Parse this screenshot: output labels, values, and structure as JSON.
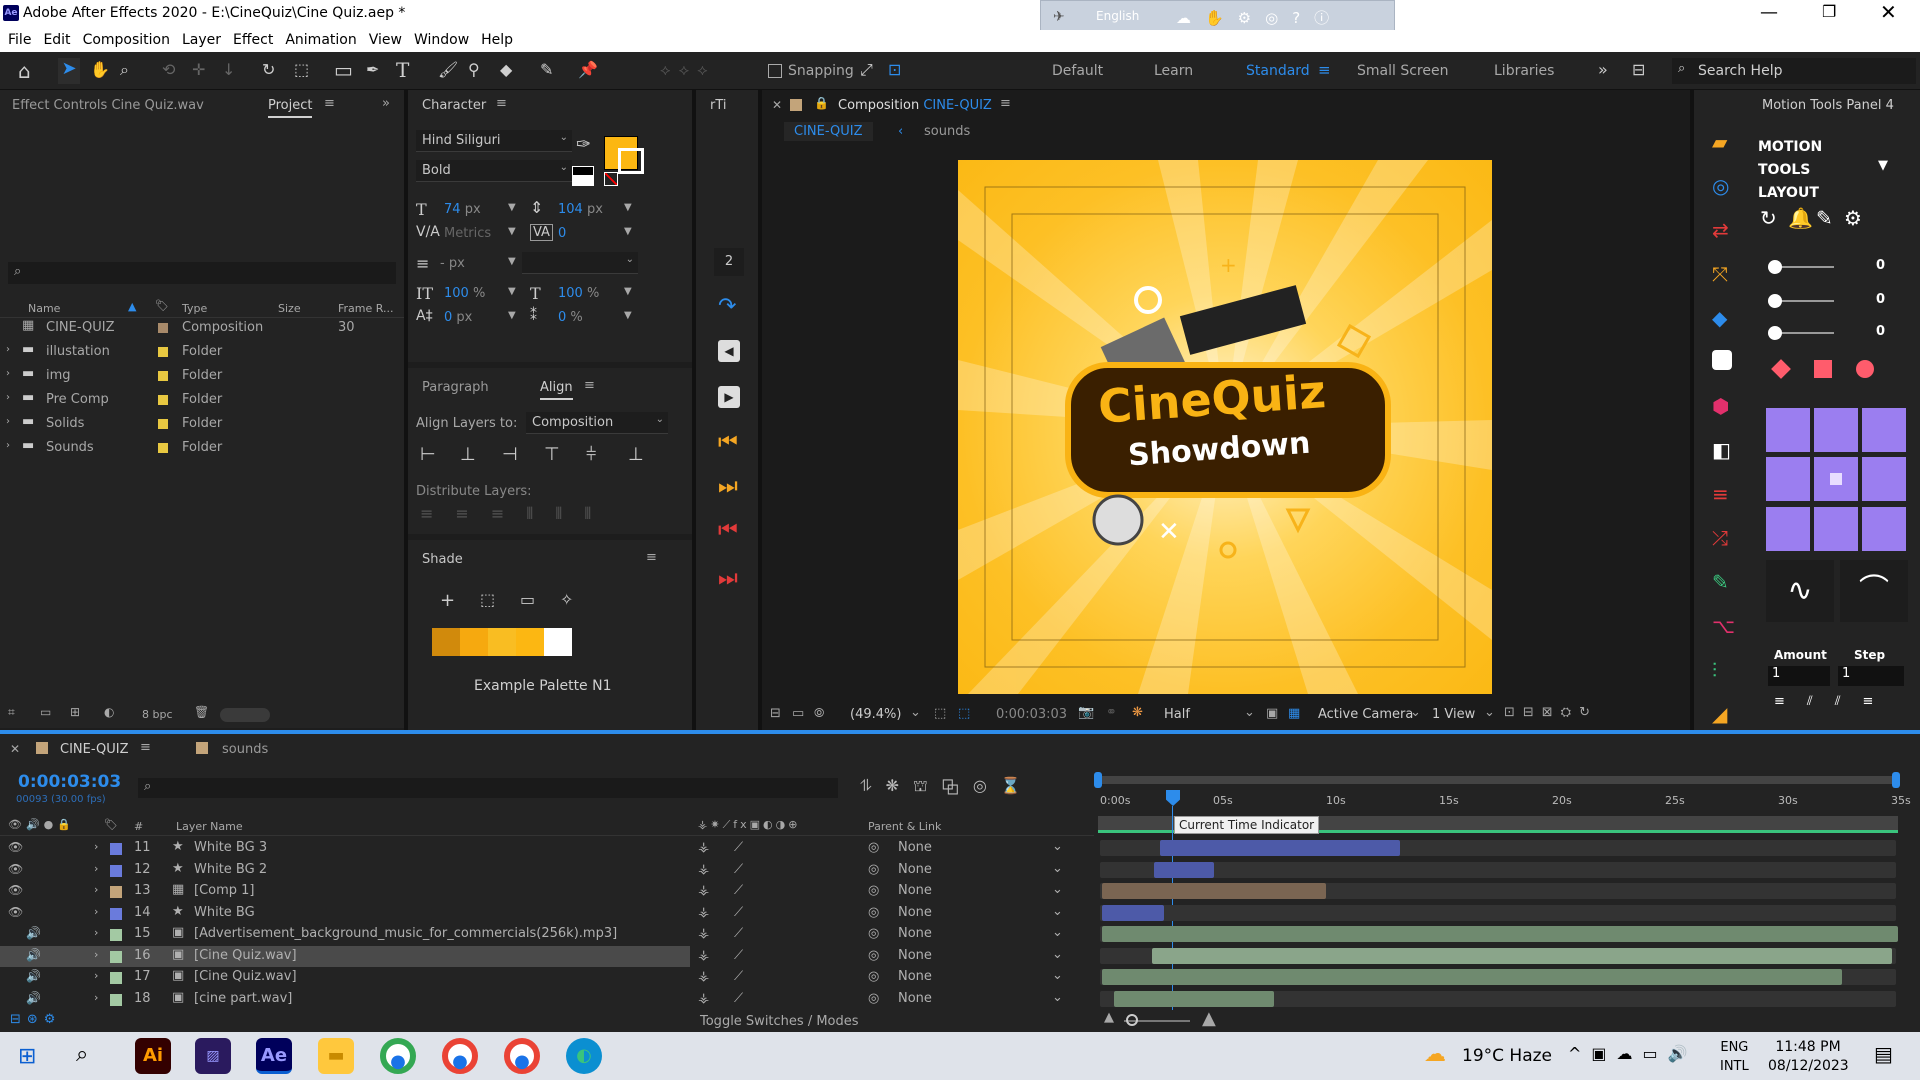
{
  "window": {
    "title": "Adobe After Effects 2020 - E:\\CineQuiz\\Cine Quiz.aep *"
  },
  "ime": {
    "language": "English"
  },
  "menu": [
    "File",
    "Edit",
    "Composition",
    "Layer",
    "Effect",
    "Animation",
    "View",
    "Window",
    "Help"
  ],
  "toolbar": {
    "snapping": "Snapping",
    "workspaces": [
      "Default",
      "Learn",
      "Standard",
      "Small Screen",
      "Libraries"
    ],
    "active_workspace": "Standard",
    "search_placeholder": "Search Help"
  },
  "left_panel": {
    "effect_tab": "Effect Controls Cine Quiz.wav",
    "project_tab": "Project",
    "columns": {
      "name": "Name",
      "type": "Type",
      "size": "Size",
      "frame_rate": "Frame R..."
    },
    "items": [
      {
        "name": "CINE-QUIZ",
        "type": "Composition",
        "fr": "30",
        "color": "#a88a6a"
      },
      {
        "name": "illustation",
        "type": "Folder",
        "fr": "",
        "color": "#e8c841"
      },
      {
        "name": "img",
        "type": "Folder",
        "fr": "",
        "color": "#e8c841"
      },
      {
        "name": "Pre Comp",
        "type": "Folder",
        "fr": "",
        "color": "#e8c841"
      },
      {
        "name": "Solids",
        "type": "Folder",
        "fr": "",
        "color": "#e8c841"
      },
      {
        "name": "Sounds",
        "type": "Folder",
        "fr": "",
        "color": "#e8c841"
      }
    ],
    "bpc": "8 bpc"
  },
  "character": {
    "tab": "Character",
    "font": "Hind Siliguri",
    "style": "Bold",
    "size": "74",
    "size_unit": "px",
    "leading": "104",
    "leading_unit": "px",
    "kerning": "Metrics",
    "tracking": "0",
    "stroke": "- px",
    "v_scale": "100",
    "h_scale": "100",
    "pct": "%",
    "baseline": "0",
    "baseline_unit": "px",
    "tsume": "0",
    "fill_color": "#fcb712"
  },
  "paragraph": {
    "tab": "Paragraph"
  },
  "align": {
    "tab": "Align",
    "align_to_label": "Align Layers to:",
    "align_to": "Composition",
    "distribute_label": "Distribute Layers:"
  },
  "shade": {
    "tab": "Shade",
    "palette_name": "Example Palette N1",
    "colors": [
      "#d18a0c",
      "#f6a90f",
      "#f9bd22",
      "#fcb712",
      "#ffffff"
    ]
  },
  "rti": {
    "tab": "rTi",
    "num": "2"
  },
  "composition": {
    "tab_prefix": "Composition",
    "name": "CINE-QUIZ",
    "breadcrumb": [
      "CINE-QUIZ",
      "sounds"
    ],
    "art": {
      "line1": "CineQuiz",
      "line2": "Showdown"
    },
    "zoom": "(49.4%)",
    "timecode": "0:00:03:03",
    "resolution": "Half",
    "camera": "Active Camera",
    "view": "1 View"
  },
  "motion_tools": {
    "tab": "Motion Tools Panel 4",
    "title_lines": [
      "MOTION",
      "TOOLS",
      "LAYOUT"
    ],
    "sliders": [
      "0",
      "0",
      "0"
    ],
    "amount_label": "Amount",
    "step_label": "Step",
    "amount": "1",
    "step": "1"
  },
  "timeline": {
    "tabs": [
      "CINE-QUIZ",
      "sounds"
    ],
    "timecode": "0:00:03:03",
    "fps": "00093 (30.00 fps)",
    "columns": {
      "num": "#",
      "layer_name": "Layer Name",
      "parent": "Parent & Link"
    },
    "ruler": [
      "0:00s",
      "05s",
      "10s",
      "15s",
      "20s",
      "25s",
      "30s",
      "35s"
    ],
    "tooltip": "Current Time Indicator",
    "toggle": "Toggle Switches / Modes",
    "layers": [
      {
        "num": "11",
        "name": "White BG 3",
        "kind": "star",
        "color": "#6a7bdc",
        "parent": "None",
        "bar_color": "#4d5aa8"
      },
      {
        "num": "12",
        "name": "White BG 2",
        "kind": "star",
        "color": "#6a7bdc",
        "parent": "None",
        "bar_color": "#4d5aa8"
      },
      {
        "num": "13",
        "name": "[Comp 1]",
        "kind": "comp",
        "color": "#c3a47a",
        "parent": "None",
        "bar_color": "#7a6552"
      },
      {
        "num": "14",
        "name": "White BG",
        "kind": "star",
        "color": "#6a7bdc",
        "parent": "None",
        "bar_color": "#4d5aa8"
      },
      {
        "num": "15",
        "name": "[Advertisement_background_music_for_commercials(256k).mp3]",
        "kind": "audio",
        "color": "#a3c9a3",
        "parent": "None",
        "bar_color": "#6f8a6f"
      },
      {
        "num": "16",
        "name": "[Cine Quiz.wav]",
        "kind": "audio",
        "color": "#a3c9a3",
        "parent": "None",
        "bar_color": "#8aa58a"
      },
      {
        "num": "17",
        "name": "[Cine Quiz.wav]",
        "kind": "audio",
        "color": "#a3c9a3",
        "parent": "None",
        "bar_color": "#6f8a6f"
      },
      {
        "num": "18",
        "name": "[cine part.wav]",
        "kind": "audio",
        "color": "#a3c9a3",
        "parent": "None",
        "bar_color": "#6f8a6f"
      }
    ]
  },
  "taskbar": {
    "weather": "19°C  Haze",
    "lang1": "ENG",
    "lang2": "INTL",
    "time": "11:48 PM",
    "date": "08/12/2023",
    "apps": [
      "Ai",
      "Pr",
      "Ae"
    ]
  }
}
